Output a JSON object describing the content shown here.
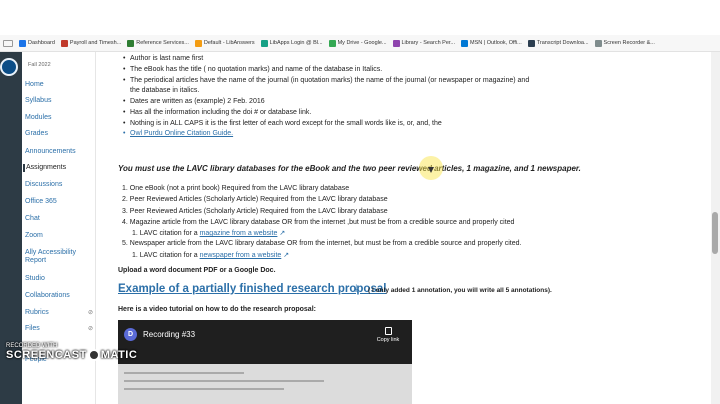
{
  "bookmarks": [
    {
      "label": "Dashboard",
      "color": "#1a73e8"
    },
    {
      "label": "Payroll and Timesh...",
      "color": "#c0392b"
    },
    {
      "label": "Reference Services...",
      "color": "#2e7d32"
    },
    {
      "label": "Default - LibAnswers",
      "color": "#f39c12"
    },
    {
      "label": "LibApps Login @ Bl...",
      "color": "#16a085"
    },
    {
      "label": "My Drive - Google...",
      "color": "#34a853"
    },
    {
      "label": "Library - Search Per...",
      "color": "#8e44ad"
    },
    {
      "label": "MSN | Outlook, Offi...",
      "color": "#0078d4"
    },
    {
      "label": "Transcript Downloa...",
      "color": "#2c3e50"
    },
    {
      "label": "Screen Recorder &...",
      "color": "#7f8c8d"
    }
  ],
  "course_nav": {
    "term": "Fall 2022",
    "items": [
      "Home",
      "Syllabus",
      "Modules",
      "Grades",
      "Announcements",
      "Assignments",
      "Discussions",
      "Office 365",
      "Chat",
      "Zoom",
      "Ally Accessibility Report",
      "Studio",
      "Collaborations",
      "Rubrics",
      "Files",
      "People"
    ],
    "active": "Assignments"
  },
  "content": {
    "bullets": [
      "Author is last name first",
      "The eBook has the title ( no quotation marks) and name of the database in Italics.",
      "The periodical articles have the name of the journal (in quotation marks) the name of the journal (or newspaper or magazine) and",
      "the database in italics.",
      "Dates are written as (example) 2 Feb. 2016",
      "Has all the information including the doi # or database link.",
      "Nothing is in ALL CAPS it is the first letter of each word except for the small words like is, or, and, the"
    ],
    "owl_link": "Owl Purdu Online Citation Guide.",
    "note": "You must use the LAVC library databases for the eBook and the two peer reviewed articles, 1 magazine, and 1 newspaper.",
    "list": {
      "i1": "1. One eBook (not a print book) Required from the LAVC library database",
      "i2": "2.  Peer Reviewed Articles (Scholarly Article) Required from the LAVC library database",
      "i3": "3.  Peer Reviewed Articles (Scholarly Article) Required from the LAVC library database",
      "i4": "4. Magazine article from the LAVC library database OR from the internet ,but must be from a credible source and properly cited",
      "i4sub_prefix": "1. LAVC citation for a ",
      "i4sub_link": "magazine from a website",
      "i5": "5. Newspaper article from the LAVC library database OR from the internet, but must be from a credible source and properly cited.",
      "i5sub_prefix": "1. LAVC citation for a ",
      "i5sub_link": "newspaper from a website"
    },
    "upload": "Upload a word document PDF or a Google Doc.",
    "example_link": "Example of a partially finished research proposal",
    "example_note": "( I only added 1 annotation, you will write all 5 annotations).",
    "video_intro": "Here is a video tutorial on how to do the research proposal:"
  },
  "video": {
    "avatar": "D",
    "title": "Recording #33",
    "copy_label": "Copy link"
  },
  "watermark": {
    "line1": "RECORDED WITH",
    "line2a": "SCREENCAST",
    "line2b": "MATIC"
  }
}
